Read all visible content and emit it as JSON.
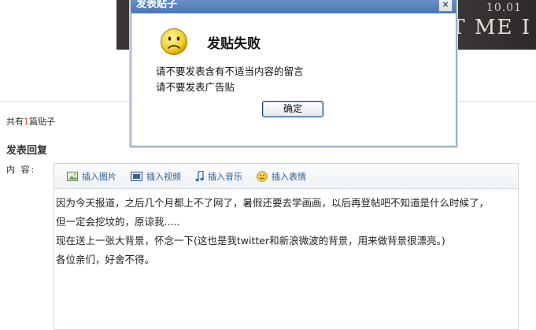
{
  "banner": {
    "date": "10.01",
    "text": "ET ME I"
  },
  "thread": {
    "count_prefix": "共有",
    "count_number": "1",
    "count_suffix": "篇贴子"
  },
  "reply": {
    "title": "发表回复",
    "content_label": "内  容:"
  },
  "toolbar": {
    "items": [
      {
        "label": "插入图片",
        "icon": "image-icon"
      },
      {
        "label": "插入视频",
        "icon": "video-icon"
      },
      {
        "label": "插入音乐",
        "icon": "music-icon"
      },
      {
        "label": "插入表情",
        "icon": "smiley-icon"
      }
    ]
  },
  "editor": {
    "lines": [
      "因为今天报道，之后几个月都上不了网了，暑假还要去学画画，以后再登帖吧不知道是什么时候了，",
      "但一定会挖坟的，原谅我.....",
      "现在送上一张大背景，怀念一下(这也是我twitter和新浪微波的背景，用来做背景很漂亮。)",
      "各位亲们，好舍不得。"
    ]
  },
  "dialog": {
    "title": "发表贴子",
    "close": "×",
    "heading": "发贴失败",
    "messages": [
      "请不要发表含有不适当内容的留言",
      "请不要发表广告贴"
    ],
    "ok_label": "确定"
  },
  "colors": {
    "accent": "#e0531b",
    "link": "#2b5d8f",
    "titlebar": "#4a76b5"
  }
}
